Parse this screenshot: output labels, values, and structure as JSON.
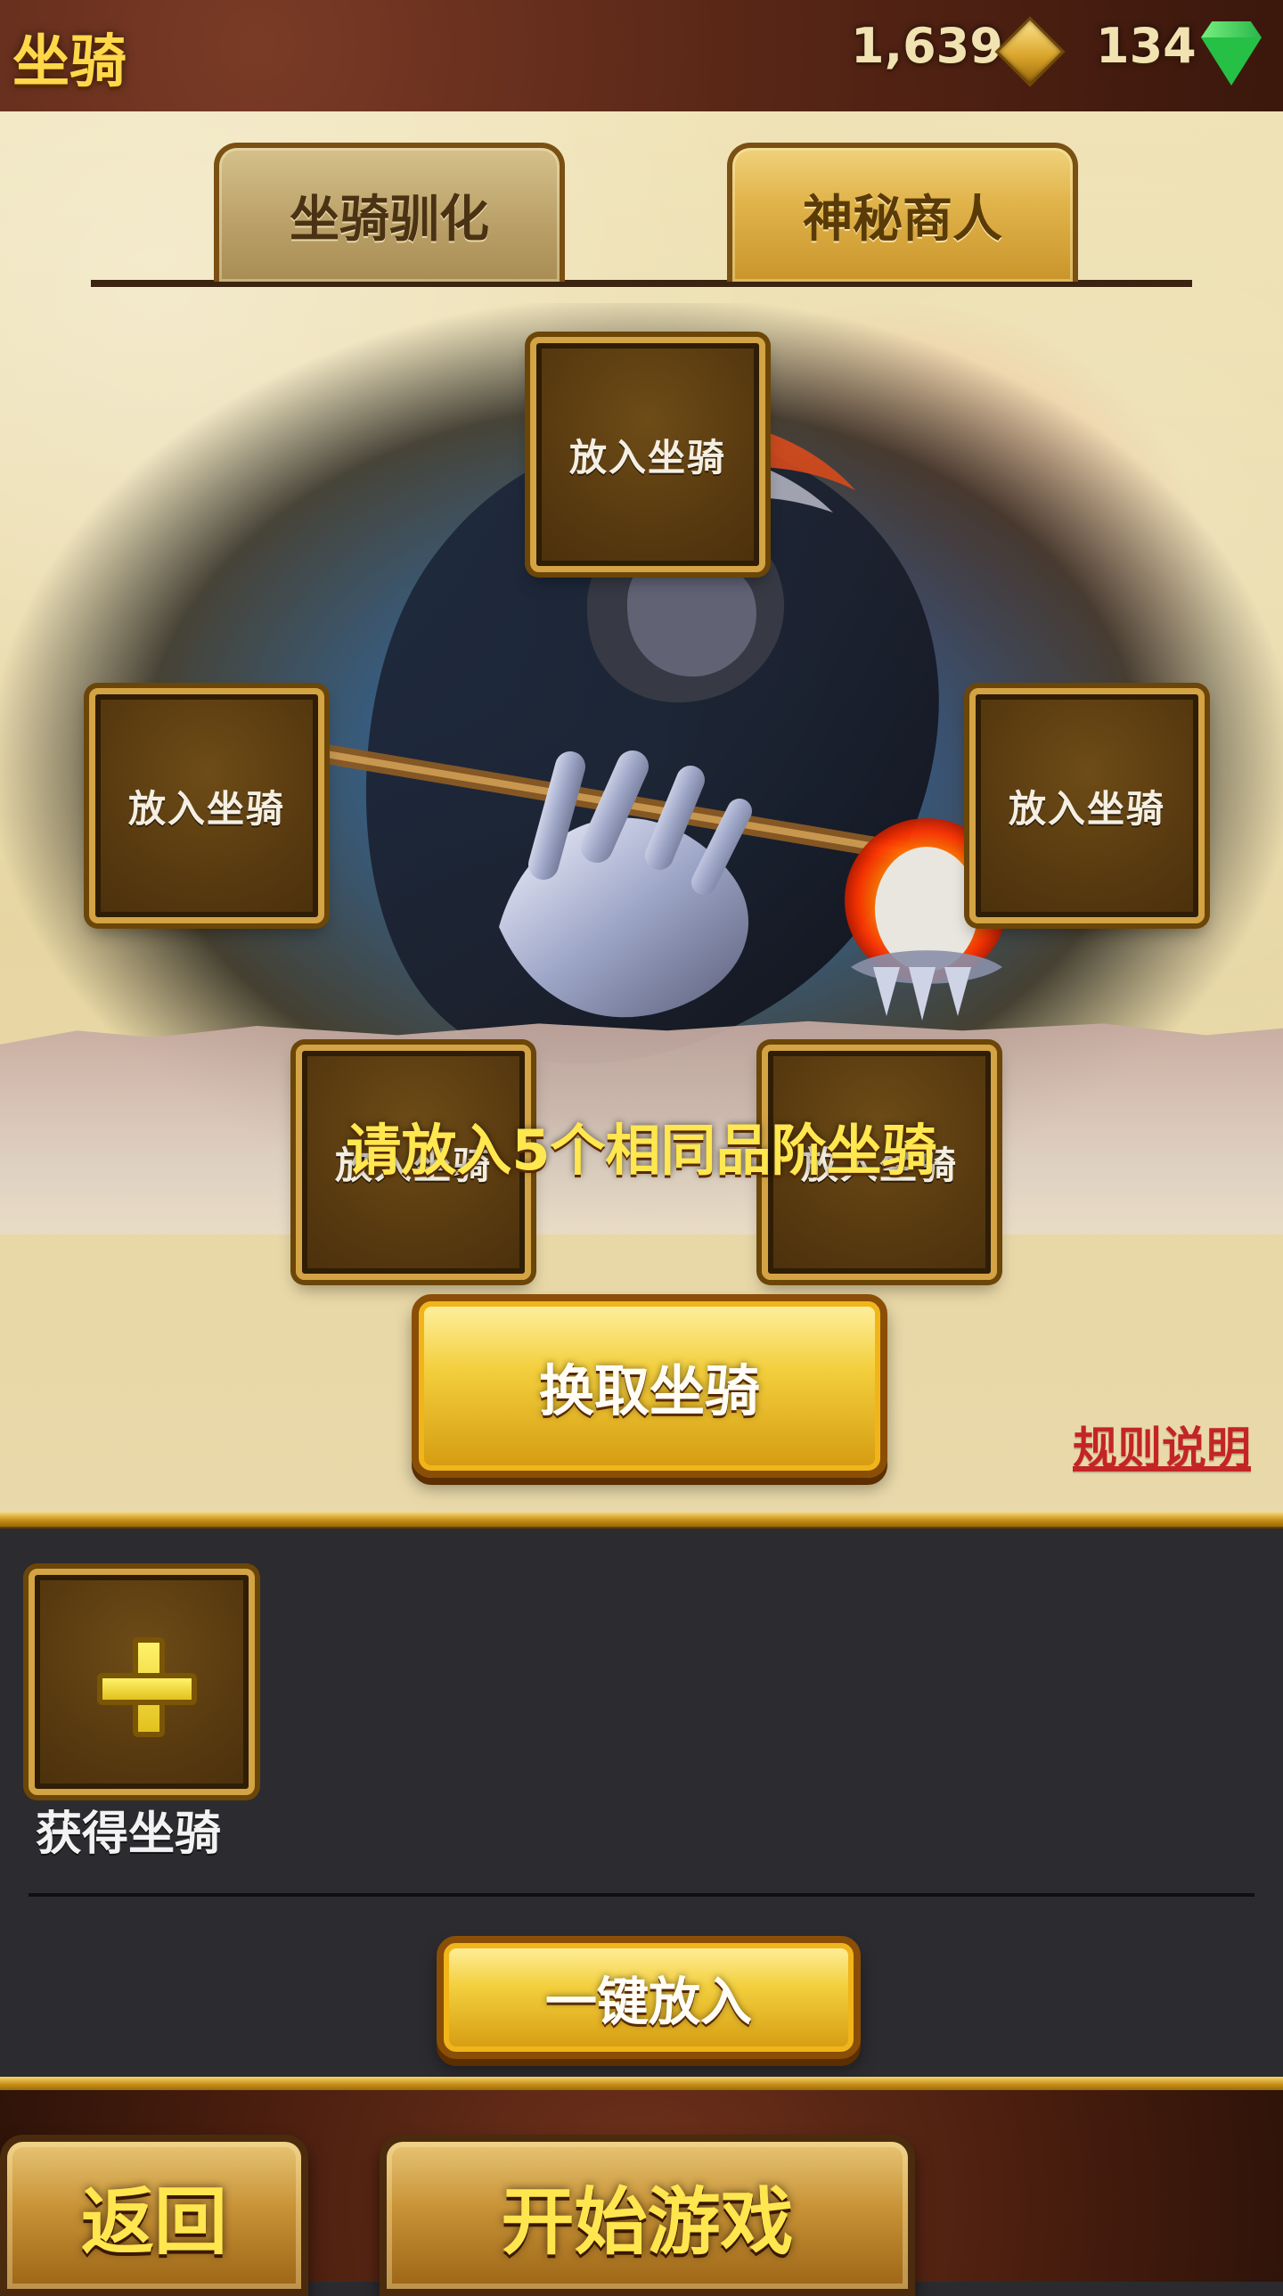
{
  "header": {
    "title": "坐骑",
    "gold_amount": "1,639",
    "gem_amount": "134"
  },
  "tabs": [
    {
      "label": "坐骑驯化",
      "state": "inactive"
    },
    {
      "label": "神秘商人",
      "state": "active"
    }
  ],
  "slots": [
    {
      "label": "放入坐骑"
    },
    {
      "label": "放入坐骑"
    },
    {
      "label": "放入坐骑"
    },
    {
      "label": "放入坐骑"
    },
    {
      "label": "放入坐骑"
    }
  ],
  "scene": {
    "instruction": "请放入5个相同品阶坐骑"
  },
  "actions": {
    "exchange_label": "换取坐骑",
    "rules_label": "规则说明",
    "add_mount_label": "获得坐骑",
    "one_click_label": "一键放入"
  },
  "footer": {
    "back_label": "返回",
    "start_label": "开始游戏"
  },
  "colors": {
    "accent_gold": "#f3cf3d",
    "link_red": "#c32525"
  },
  "icons": {
    "gold": "gold-diamond-icon",
    "gem": "green-gem-icon",
    "plus": "plus-icon"
  }
}
